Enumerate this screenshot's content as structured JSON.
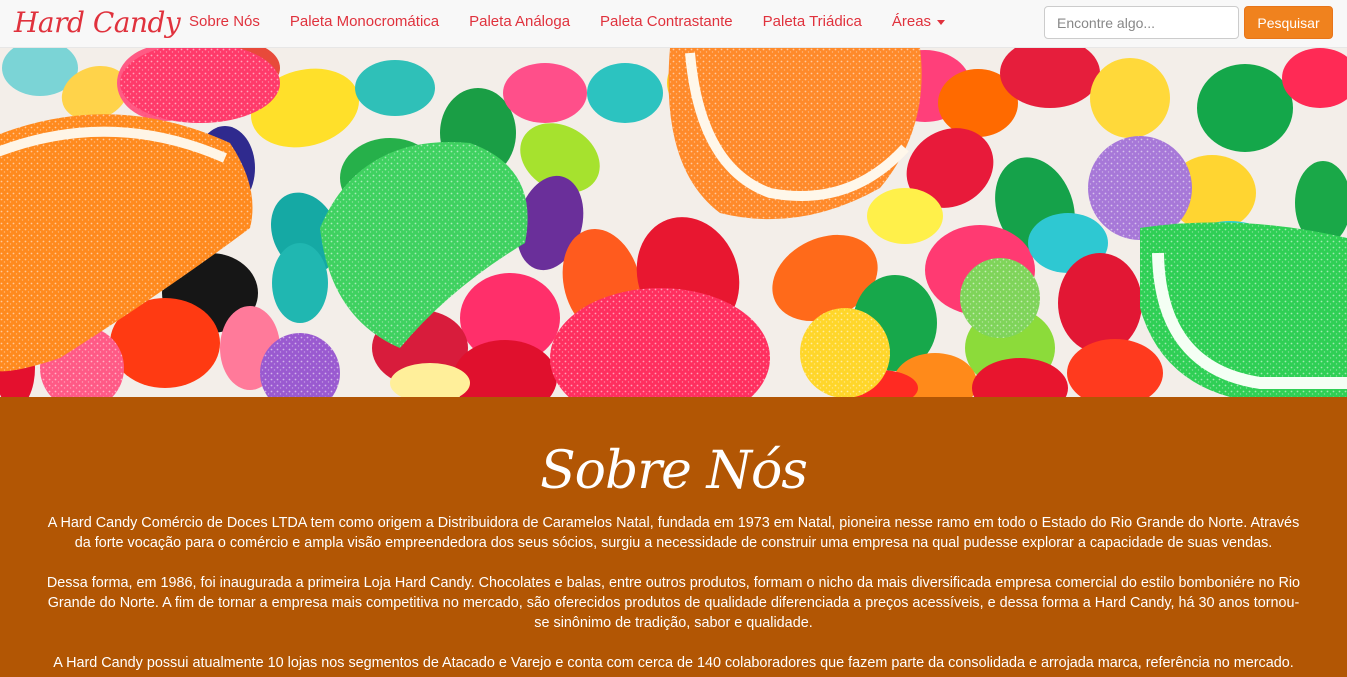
{
  "navbar": {
    "brand": "Hard Candy",
    "links": [
      {
        "label": "Sobre Nós"
      },
      {
        "label": "Paleta Monocromática"
      },
      {
        "label": "Paleta Análoga"
      },
      {
        "label": "Paleta Contrastante"
      },
      {
        "label": "Paleta Triádica"
      },
      {
        "label": "Áreas"
      }
    ],
    "search": {
      "placeholder": "Encontre algo...",
      "value": "",
      "button_label": "Pesquisar"
    }
  },
  "hero": {
    "image": "candy-banner"
  },
  "about": {
    "title": "Sobre Nós",
    "paragraphs": [
      "A Hard Candy Comércio de Doces LTDA tem como origem a Distribuidora de Caramelos Natal, fundada em 1973 em Natal, pioneira nesse ramo em todo o Estado do Rio Grande do Norte. Através da forte vocação para o comércio e ampla visão empreendedora dos seus sócios, surgiu a necessidade de construir uma empresa na qual pudesse explorar a capacidade de suas vendas.",
      "Dessa forma, em 1986, foi inaugurada a primeira Loja Hard Candy. Chocolates e balas, entre outros produtos, formam o nicho da mais diversificada empresa comercial do estilo bomboniére no Rio Grande do Norte. A fim de tornar a empresa mais competitiva no mercado, são oferecidos produtos de qualidade diferenciada a preços acessíveis, e dessa forma a Hard Candy, há 30 anos tornou-se sinônimo de tradição, sabor e qualidade.",
      "A Hard Candy possui atualmente 10 lojas nos segmentos de Atacado e Varejo e conta com cerca de 140 colaboradores que fazem parte da consolidada e arrojada marca, referência no mercado."
    ]
  },
  "colors": {
    "brand_red": "#e0323d",
    "search_button": "#f0821e",
    "about_background": "#b25604"
  },
  "icons": {
    "dropdown": "caret-down-icon"
  }
}
